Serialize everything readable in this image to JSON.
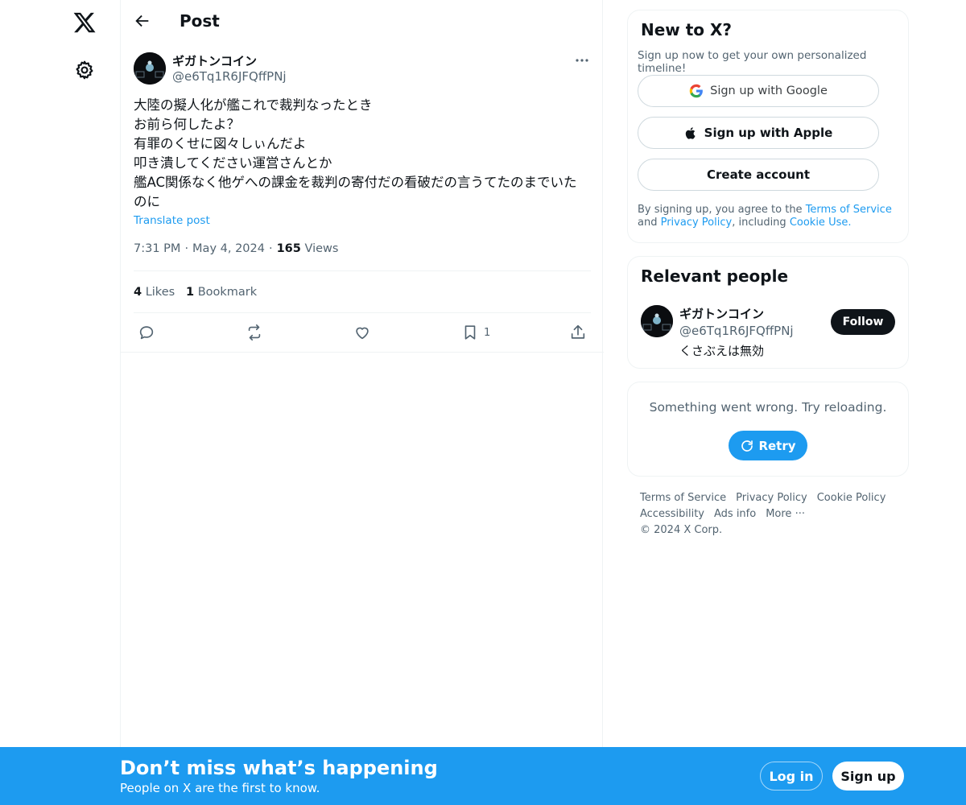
{
  "header": {
    "title": "Post"
  },
  "post": {
    "author_name": "ギガトンコイン",
    "author_handle": "@e6Tq1R6JFQffPNj",
    "text_lines": [
      "大陸の擬人化が艦これで裁判なったとき",
      "お前ら何したよ？",
      "有罪のくせに図々しぃんだよ",
      "叩き潰してください運営さんとか",
      "艦AC関係なく他ゲへの課金を裁判の寄付だの看破だの言うてたのまでいた",
      "のに"
    ],
    "translate_label": "Translate post",
    "time": "7:31 PM",
    "date": "May 4, 2024",
    "views_count": "165",
    "views_label": "Views",
    "likes_count": "4",
    "likes_label": "Likes",
    "bookmarks_count": "1",
    "bookmarks_label": "Bookmark",
    "action_bookmark_count": "1"
  },
  "signup_card": {
    "title": "New to X?",
    "subtitle": "Sign up now to get your own personalized timeline!",
    "google_label": "Sign up with Google",
    "apple_label": "Sign up with Apple",
    "create_label": "Create account",
    "legal_prefix": "By signing up, you agree to the ",
    "terms_link": "Terms of Service",
    "legal_and": " and ",
    "privacy_link": "Privacy Policy",
    "legal_including": ", including ",
    "cookie_link": "Cookie Use",
    "legal_end": "."
  },
  "relevant": {
    "title": "Relevant people",
    "name": "ギガトンコイン",
    "handle": "@e6Tq1R6JFQffPNj",
    "bio": "くさぶえは無効",
    "follow_label": "Follow"
  },
  "error_card": {
    "message": "Something went wrong. Try reloading.",
    "retry_label": "Retry"
  },
  "footer": {
    "links": [
      "Terms of Service",
      "Privacy Policy",
      "Cookie Policy",
      "Accessibility",
      "Ads info",
      "More ···",
      "© 2024 X Corp."
    ]
  },
  "banner": {
    "title": "Don’t miss what’s happening",
    "subtitle": "People on X are the first to know.",
    "login_label": "Log in",
    "signup_label": "Sign up"
  },
  "colors": {
    "accent": "#1d9bf0",
    "text": "#0f1419",
    "muted": "#536471",
    "border": "#eff3f4"
  }
}
